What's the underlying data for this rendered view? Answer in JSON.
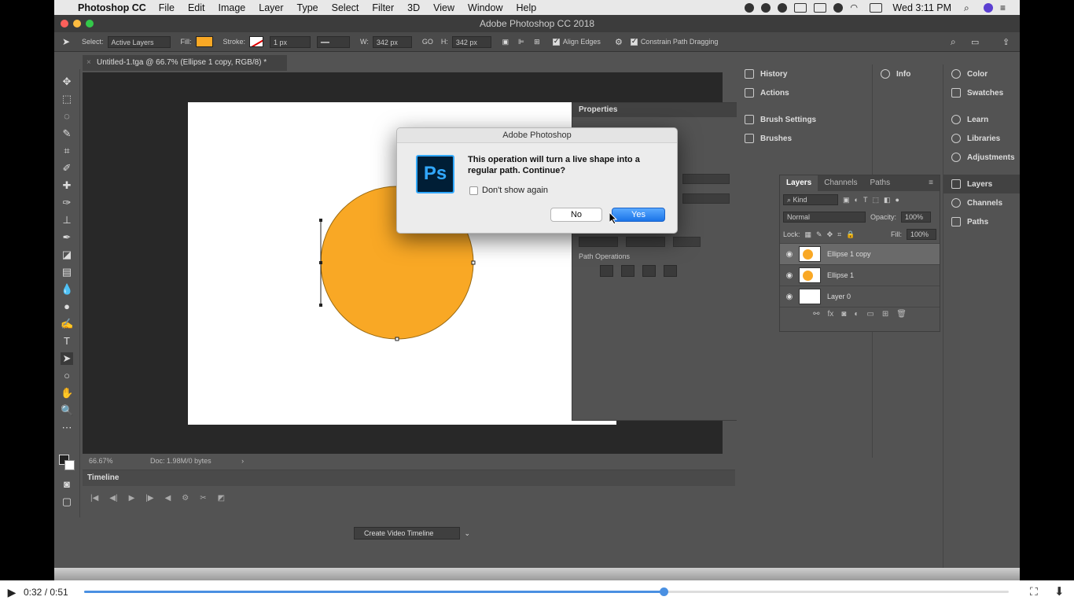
{
  "menubar": {
    "app_name": "Photoshop CC",
    "items": [
      "File",
      "Edit",
      "Image",
      "Layer",
      "Type",
      "Select",
      "Filter",
      "3D",
      "View",
      "Window",
      "Help"
    ],
    "clock": "Wed 3:11 PM"
  },
  "window": {
    "title": "Adobe Photoshop CC 2018"
  },
  "options_bar": {
    "select_label": "Select:",
    "select_value": "Active Layers",
    "fill_label": "Fill:",
    "stroke_label": "Stroke:",
    "stroke_width": "1 px",
    "w_label": "W:",
    "w_value": "342 px",
    "h_label": "H:",
    "h_value": "342 px",
    "align_edges": "Align Edges",
    "constrain": "Constrain Path Dragging",
    "fill_color": "#f9a825"
  },
  "document": {
    "tab_title": "Untitled-1.tga @ 66.7% (Ellipse 1 copy, RGB/8) *",
    "zoom": "66.67%",
    "doc_info": "Doc: 1.98M/0 bytes"
  },
  "properties": {
    "title": "Properties",
    "path_operations": "Path Operations"
  },
  "panels_collapsed": {
    "history": "History",
    "actions": "Actions",
    "brush_settings": "Brush Settings",
    "brushes": "Brushes",
    "info": "Info"
  },
  "panels_right": [
    "Color",
    "Swatches",
    "Learn",
    "Libraries",
    "Adjustments",
    "Layers",
    "Channels",
    "Paths"
  ],
  "layers_panel": {
    "tabs": [
      "Layers",
      "Channels",
      "Paths"
    ],
    "kind": "Kind",
    "blend_mode": "Normal",
    "opacity_label": "Opacity:",
    "opacity_value": "100%",
    "lock_label": "Lock:",
    "fill_label": "Fill:",
    "fill_value": "100%",
    "layers": [
      {
        "name": "Ellipse 1 copy",
        "selected": true
      },
      {
        "name": "Ellipse 1",
        "selected": false
      },
      {
        "name": "Layer 0",
        "selected": false
      }
    ]
  },
  "timeline": {
    "title": "Timeline",
    "create_button": "Create Video Timeline"
  },
  "dialog": {
    "title": "Adobe Photoshop",
    "logo_text": "Ps",
    "message": "This operation will turn a live shape into a regular path. Continue?",
    "checkbox_label": "Don't show again",
    "no_label": "No",
    "yes_label": "Yes"
  },
  "player": {
    "time": "0:32 / 0:51",
    "progress_fraction": 0.627
  },
  "colors": {
    "ellipse": "#f9a825",
    "accent": "#4a90e2"
  }
}
